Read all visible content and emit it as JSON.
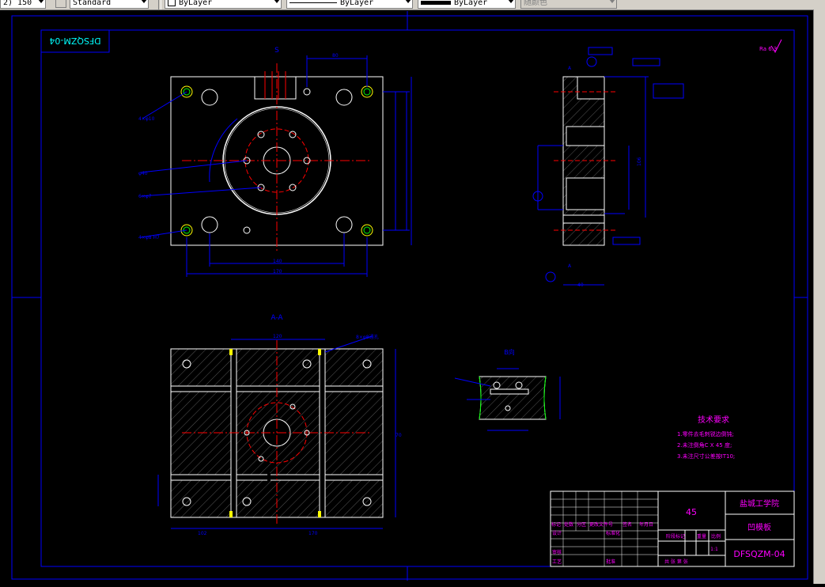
{
  "toolbar": {
    "scale_text": "2) 150",
    "textstyle": "Standard",
    "layer_color": "ByLayer",
    "linetype": "ByLayer",
    "lineweight": "ByLayer",
    "plotstyle": "随颜色"
  },
  "drawing": {
    "drawing_number": "DFSQZM-04",
    "mirrored_number": "DFSQZM-04",
    "section_label": "A-A",
    "view_b_label": "B向",
    "view_s_label": "S",
    "roughness_note": "Ra 6.3",
    "material": "45",
    "school": "盐城工学院",
    "part_name": "凹模板",
    "scale": "1:1",
    "tech_req_title": "技术要求",
    "tech_req_lines": [
      "1.零件去毛刺锐边倒钝;",
      "2.未注倒角C X 45 度;",
      "3.未注尺寸公差按IT10;"
    ],
    "title_block": {
      "headers": [
        "标记",
        "处数",
        "分区",
        "更改文件号",
        "签名",
        "年月日"
      ],
      "design": "设计",
      "standard": "标准化",
      "review": "审核",
      "process": "工艺",
      "approve": "批准",
      "stage_mark": "阶段标记",
      "weight": "重量",
      "scale_label": "比例",
      "sheets": "共 张 第 张"
    }
  },
  "colors": {
    "background": "#000000",
    "outline": "#ffffff",
    "dimension": "#0000ff",
    "centerline": "#ff0000",
    "text_magenta": "#ff00ff",
    "text_cyan": "#00ffff",
    "hatch": "#666666",
    "yellow": "#ffff00",
    "green": "#00ff00"
  }
}
